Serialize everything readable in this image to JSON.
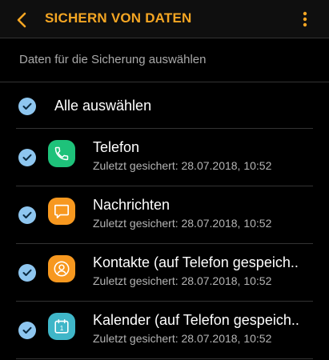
{
  "app_bar": {
    "title": "SICHERN VON DATEN",
    "back_icon": "chevron-left-icon",
    "more_icon": "more-vertical-icon",
    "accent_color": "#f5a623"
  },
  "section": {
    "header": "Daten für die Sicherung auswählen"
  },
  "select_all": {
    "label": "Alle auswählen",
    "checked": true
  },
  "items": [
    {
      "title": "Telefon",
      "subtitle": "Zuletzt gesichert: 28.07.2018, 10:52",
      "checked": true,
      "icon": "phone-icon",
      "icon_color": "#1ec27a"
    },
    {
      "title": "Nachrichten",
      "subtitle": "Zuletzt gesichert: 28.07.2018, 10:52",
      "checked": true,
      "icon": "message-icon",
      "icon_color": "#f7981f"
    },
    {
      "title": "Kontakte (auf Telefon gespeich..",
      "subtitle": "Zuletzt gesichert: 28.07.2018, 10:52",
      "checked": true,
      "icon": "contact-icon",
      "icon_color": "#f7981f"
    },
    {
      "title": "Kalender (auf Telefon gespeich..",
      "subtitle": "Zuletzt gesichert: 28.07.2018, 10:52",
      "checked": true,
      "icon": "calendar-icon",
      "icon_color": "#3fb6c8",
      "icon_text": "1"
    }
  ],
  "colors": {
    "checkbox": "#8ec6ef",
    "divider": "#333333",
    "subtitle": "#b4b4b4"
  }
}
